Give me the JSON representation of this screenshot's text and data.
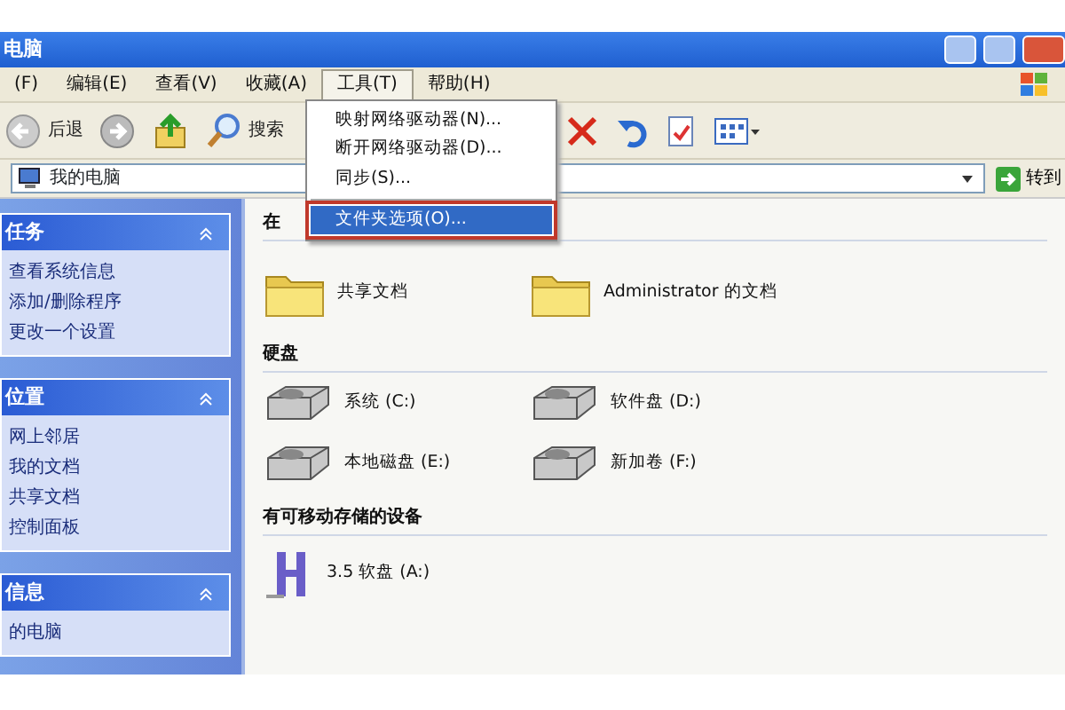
{
  "window": {
    "title": "电脑"
  },
  "menu_bar": [
    {
      "label": "(F)",
      "open": false
    },
    {
      "label": "编辑(E)",
      "open": false
    },
    {
      "label": "查看(V)",
      "open": false
    },
    {
      "label": "收藏(A)",
      "open": false
    },
    {
      "label": "工具(T)",
      "open": true
    },
    {
      "label": "帮助(H)",
      "open": false
    }
  ],
  "tools_menu": {
    "items": [
      {
        "label": "映射网络驱动器(N)...",
        "selected": false,
        "separator_before": false
      },
      {
        "label": "断开网络驱动器(D)...",
        "selected": false,
        "separator_before": false
      },
      {
        "label": "同步(S)...",
        "selected": false,
        "separator_before": false
      },
      {
        "label": "文件夹选项(O)...",
        "selected": true,
        "separator_before": true
      }
    ]
  },
  "toolbar": [
    {
      "kind": "back",
      "label": "后退"
    },
    {
      "kind": "forward"
    },
    {
      "kind": "up"
    },
    {
      "kind": "search",
      "label": "搜索"
    },
    {
      "kind": "delete"
    },
    {
      "kind": "undo"
    },
    {
      "kind": "properties"
    },
    {
      "kind": "views"
    }
  ],
  "address_bar": {
    "value": "我的电脑",
    "go_label": "转到"
  },
  "task_panes": [
    {
      "title": "任务",
      "items": [
        "查看系统信息",
        "添加/删除程序",
        "更改一个设置"
      ]
    },
    {
      "title": "位置",
      "items": [
        "网上邻居",
        "我的文档",
        "共享文档",
        "控制面板"
      ]
    },
    {
      "title": "信息",
      "items": [
        "的电脑"
      ]
    }
  ],
  "sections": [
    {
      "title": "在",
      "items": [
        {
          "kind": "folder",
          "label": "共享文档"
        },
        {
          "kind": "folder",
          "label": "Administrator 的文档"
        }
      ]
    },
    {
      "title": "硬盘",
      "items": [
        {
          "kind": "drive",
          "label": "系统 (C:)"
        },
        {
          "kind": "drive",
          "label": "软件盘 (D:)"
        },
        {
          "kind": "drive",
          "label": "本地磁盘 (E:)"
        },
        {
          "kind": "drive",
          "label": "新加卷 (F:)"
        }
      ]
    },
    {
      "title": "有可移动存储的设备",
      "items": [
        {
          "kind": "floppy",
          "label": "3.5 软盘 (A:)"
        }
      ]
    }
  ]
}
